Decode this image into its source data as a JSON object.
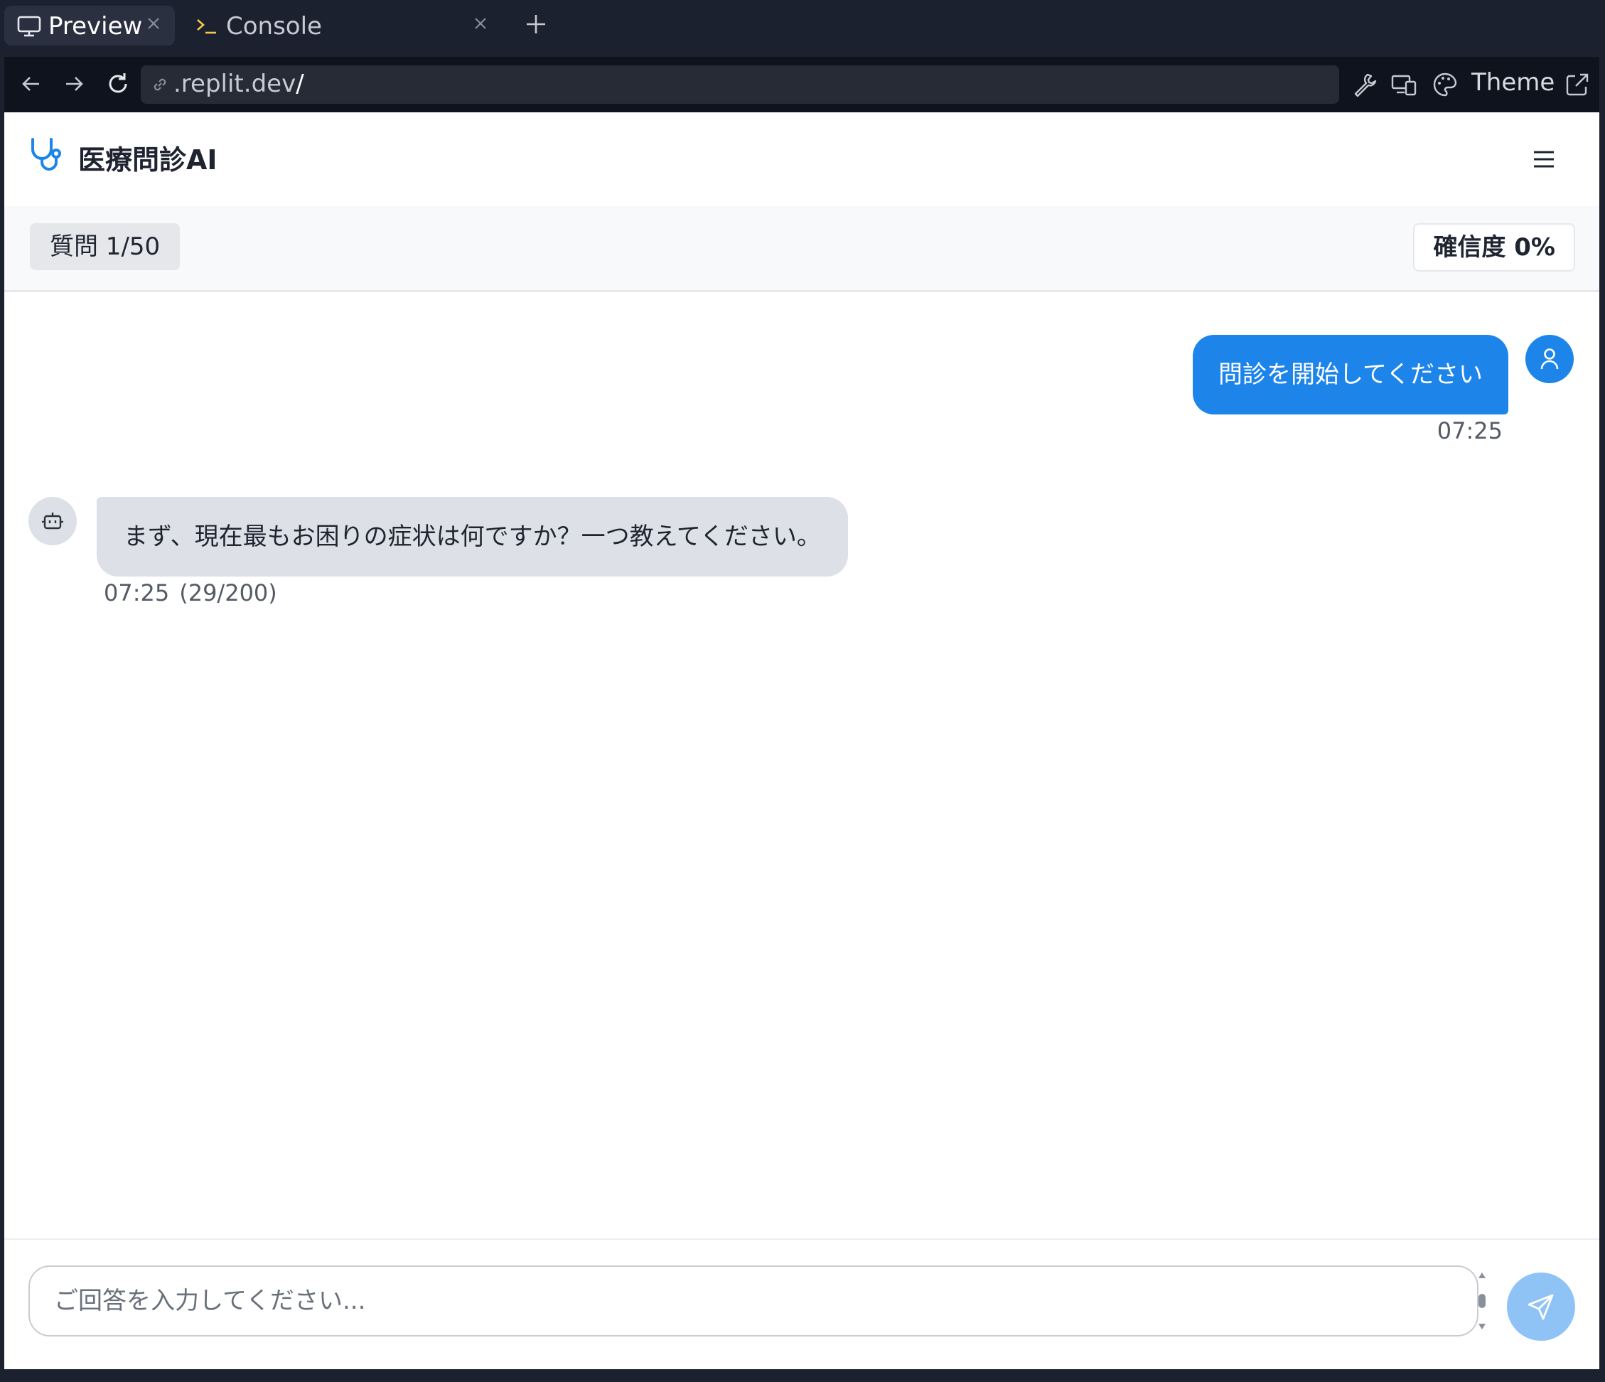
{
  "browser": {
    "tabs": [
      {
        "label": "Preview",
        "icon": "monitor-icon",
        "active": true
      },
      {
        "label": "Console",
        "icon": "terminal-icon",
        "active": false
      }
    ],
    "address": {
      "url": ".replit.dev",
      "slash": "/"
    },
    "theme_label": "Theme"
  },
  "app": {
    "title": "医療問診AI",
    "question_counter": "質問 1/50",
    "confidence": "確信度 0%"
  },
  "messages": [
    {
      "role": "user",
      "text": "問診を開始してください",
      "time": "07:25"
    },
    {
      "role": "assistant",
      "text": "まず、現在最もお困りの症状は何ですか？一つ教えてください。",
      "time": "07:25",
      "char_count": "(29/200)"
    }
  ],
  "composer": {
    "placeholder": "ご回答を入力してください..."
  },
  "colors": {
    "accent": "#1d85ea",
    "send_disabled": "#8fc3f5",
    "bot_bubble": "#dde1e7",
    "chrome_dark": "#1c2130"
  }
}
